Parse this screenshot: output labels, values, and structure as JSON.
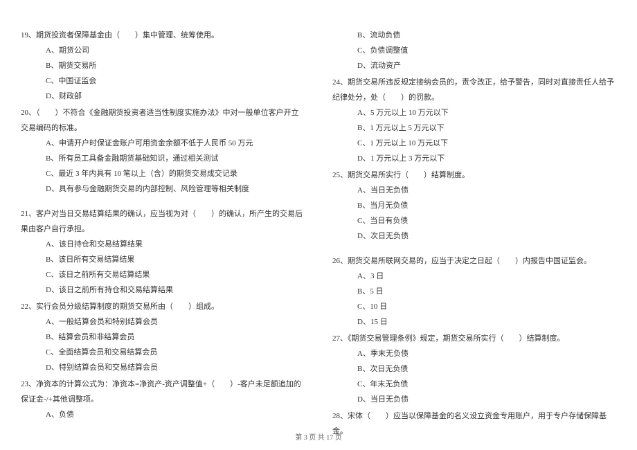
{
  "left": {
    "q19": {
      "text": "19、期货投资者保障基金由（　　）集中管理、统筹使用。",
      "opts": [
        "A、期货公司",
        "B、期货交易所",
        "C、中国证监会",
        "D、财政部"
      ]
    },
    "q20": {
      "text": "20、（　　）不符合《金融期货投资者适当性制度实施办法》中对一般单位客户开立交易编码的标准。",
      "opts": [
        "A、申请开户时保证金账户可用资金余额不低于人民币 50 万元",
        "B、所有员工具备金融期货基础知识，通过相关测试",
        "C、最近 3 年内具有 10 笔以上（含）的期货交易成交记录",
        "D、具有参与金融期货交易的内部控制、风险管理等相关制度"
      ]
    },
    "q21": {
      "text": "21、客户对当日交易结算结果的确认，应当视为对（　　）的确认，所产生的交易后果由客户自行承担。",
      "opts": [
        "A、该日持仓和交易结算结果",
        "B、该日所有交易结算结果",
        "C、该日之前所有交易结算结果",
        "D、该日之前所有持仓和交易结算结果"
      ]
    },
    "q22": {
      "text": "22、实行会员分级结算制度的期货交易所由（　　）组成。",
      "opts": [
        "A、一般结算会员和特别结算会员",
        "B、结算会员和非结算会员",
        "C、全面结算会员和交易结算会员",
        "D、特别结算会员和交易结算会员"
      ]
    },
    "q23": {
      "text": "23、净资本的计算公式为：净资本=净资产-资产调整值+（　　）-客户未足额追加的保证金-/+其他调整项。",
      "opts": [
        "A、负债"
      ]
    }
  },
  "right": {
    "q23r": {
      "opts": [
        "B、流动负债",
        "C、负债调整值",
        "D、流动资产"
      ]
    },
    "q24": {
      "text": "24、期货交易所违反规定接纳会员的，责令改正，给予警告，同时对直接责任人给予纪律处分，处（　　）的罚款。",
      "opts": [
        "A、5 万元以上 10 万元以下",
        "B、1 万元以上 5 万元以下",
        "C、1 万元以上 10 万元以下",
        "D、1 万元以上 3 万元以下"
      ]
    },
    "q25": {
      "text": "25、期货交易所实行（　　）结算制度。",
      "opts": [
        "A、当日无负债",
        "B、当月无负债",
        "C、当日有负债",
        "D、次日无负债"
      ]
    },
    "q26": {
      "text": "26、期货交易所联网交易的，应当于决定之日起（　　）内报告中国证监会。",
      "opts": [
        "A、3 日",
        "B、5 日",
        "C、10 日",
        "D、15 日"
      ]
    },
    "q27": {
      "text": "27、《期货交易管理条例》规定，期货交易所实行（　　）结算制度。",
      "opts": [
        "A、季末无负债",
        "B、次日无负债",
        "C、年末无负债",
        "D、当日无负债"
      ]
    },
    "q28": {
      "text": "28、宋体（　　）应当以保障基金的名义设立资金专用账户，用于专户存储保障基金。"
    }
  },
  "footer": "第 3 页 共 17 页"
}
